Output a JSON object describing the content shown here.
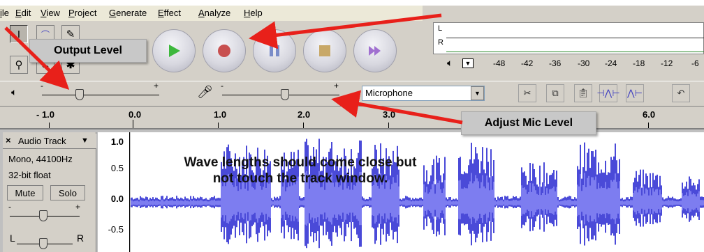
{
  "menubar": {
    "items": [
      "File",
      "Edit",
      "View",
      "Project",
      "Generate",
      "Effect",
      "Analyze",
      "Help"
    ],
    "visible_labels": [
      "ile",
      "Edit",
      "View",
      "Project",
      "Generate",
      "Effect",
      "Analyze",
      "Help"
    ]
  },
  "meter": {
    "channel_left": "L",
    "channel_right": "R",
    "ticks": [
      "-48",
      "-42",
      "-36",
      "-30",
      "-24",
      "-18",
      "-12",
      "-6"
    ]
  },
  "input": {
    "selected": "Microphone"
  },
  "ruler": {
    "labels": [
      "- 1.0",
      "0.0",
      "1.0",
      "2.0",
      "3.0",
      "6.0"
    ]
  },
  "track": {
    "name": "Audio Track",
    "rate": "Mono, 44100Hz",
    "format": "32-bit float",
    "mute_label": "Mute",
    "solo_label": "Solo",
    "pan_left": "L",
    "pan_right": "R",
    "vruler": [
      "1.0",
      "0.5",
      "0.0",
      "-0.5"
    ]
  },
  "annotations": {
    "output_level": "Output Level",
    "adjust_mic": "Adjust Mic Level",
    "wave_note_line1": "Wave lengths should come close but",
    "wave_note_line2": "not touch the track window."
  },
  "colors": {
    "waveform": "#4a4ad8",
    "waveform_light": "#7d7df0",
    "arrow": "#e8201a",
    "chrome": "#d4d0c8"
  },
  "icons": {
    "play": "play-icon",
    "record": "record-icon",
    "pause": "pause-icon",
    "stop": "stop-icon",
    "skip_end": "skip-end-icon"
  }
}
